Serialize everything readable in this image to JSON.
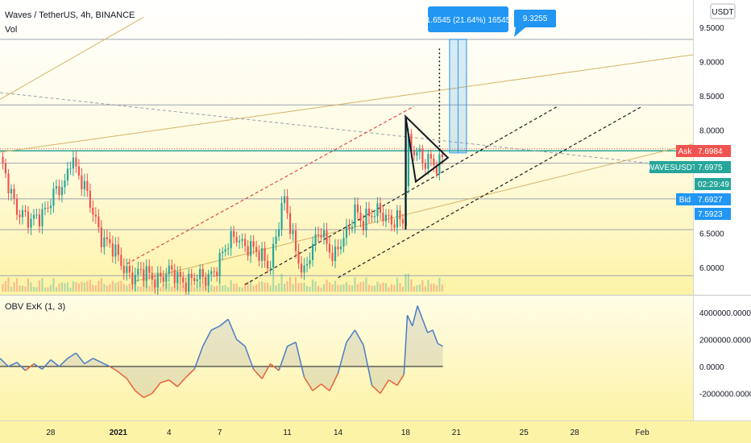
{
  "header": {
    "title": "Waves / TetherUS, 4h, BINANCE",
    "volume_label": "Vol",
    "currency_button": "USDT",
    "indicator_label": "OBV ExK (1, 3)"
  },
  "measure": {
    "label": "1.6545 (21.64%) 16545",
    "target_label": "9.3255"
  },
  "price_tags": {
    "ask_label": "Ask",
    "ask_value": "7.6984",
    "symbol_label": "WAVESUSDT",
    "last_value": "7.6975",
    "countdown": "02:29:49",
    "bid_label": "Bid",
    "bid_value": "7.6927",
    "level_value": "7.5923"
  },
  "colors": {
    "up": "#26a69a",
    "down": "#ef5350",
    "background_top": "#ffffff",
    "background_bottom": "#fdf3a6",
    "obv_above": "#4a7dc4",
    "obv_below": "#e8613b",
    "ask_tag": "#ef5350",
    "symbol_tag": "#26a69a",
    "bid_tag": "#2196f3",
    "measure_box": "#2196f3",
    "horizontal_level": "#9ea3b0"
  },
  "chart_data": [
    {
      "type": "candlestick",
      "title": "Waves / TetherUS, 4h, BINANCE",
      "y_ticks": [
        9.5,
        9.0,
        8.5,
        8.0,
        7.5,
        7.0,
        6.5,
        6.0
      ],
      "y_tick_labels": [
        "9.5000",
        "9.0000",
        "8.5000",
        "8.0000",
        "7.5000",
        "7.0000",
        "6.5000",
        "6.0000"
      ],
      "ylim": [
        5.7,
        9.65
      ],
      "x_tick_labels": [
        "28",
        "2021",
        "4",
        "7",
        "11",
        "14",
        "18",
        "21",
        "25",
        "28",
        "Feb"
      ],
      "x_ticks_day": [
        -4,
        0,
        3,
        6,
        10,
        13,
        17,
        20,
        24,
        27,
        31
      ],
      "xlim_day": [
        -7.0,
        34.0
      ],
      "horizontal_levels": [
        9.3255,
        8.37,
        7.7,
        7.52,
        7.0,
        6.55,
        5.88
      ],
      "anchors": [
        {
          "day": -7.0,
          "price": 7.5
        },
        {
          "day": -6.0,
          "price": 6.9
        },
        {
          "day": -5.2,
          "price": 6.6
        },
        {
          "day": -4.0,
          "price": 7.0
        },
        {
          "day": -3.2,
          "price": 7.15
        },
        {
          "day": -2.8,
          "price": 7.7
        },
        {
          "day": -2.0,
          "price": 7.1
        },
        {
          "day": -1.0,
          "price": 6.5
        },
        {
          "day": 0.0,
          "price": 6.1
        },
        {
          "day": 1.0,
          "price": 5.88
        },
        {
          "day": 3.0,
          "price": 5.88
        },
        {
          "day": 5.0,
          "price": 5.8
        },
        {
          "day": 6.0,
          "price": 6.1
        },
        {
          "day": 7.0,
          "price": 6.5
        },
        {
          "day": 8.0,
          "price": 6.2
        },
        {
          "day": 9.0,
          "price": 6.1
        },
        {
          "day": 9.8,
          "price": 6.95
        },
        {
          "day": 10.5,
          "price": 6.3
        },
        {
          "day": 11.0,
          "price": 5.9
        },
        {
          "day": 12.0,
          "price": 6.6
        },
        {
          "day": 12.8,
          "price": 6.1
        },
        {
          "day": 13.5,
          "price": 6.5
        },
        {
          "day": 14.0,
          "price": 6.9
        },
        {
          "day": 14.5,
          "price": 6.6
        },
        {
          "day": 15.5,
          "price": 6.9
        },
        {
          "day": 16.2,
          "price": 6.6
        },
        {
          "day": 16.9,
          "price": 6.7
        },
        {
          "day": 17.1,
          "price": 7.9
        },
        {
          "day": 17.6,
          "price": 7.7
        },
        {
          "day": 18.1,
          "price": 7.45
        },
        {
          "day": 18.6,
          "price": 7.6
        },
        {
          "day": 18.9,
          "price": 7.5
        },
        {
          "day": 19.2,
          "price": 7.7
        }
      ],
      "volume_scale": 6
    },
    {
      "type": "area",
      "title": "OBV ExK (1, 3)",
      "y_ticks": [
        4000000,
        2000000,
        0,
        -2000000
      ],
      "y_tick_labels": [
        "4000000.0000",
        "2000000.0000",
        "0.0000",
        "-2000000.0000"
      ],
      "ylim": [
        -2800000,
        5000000
      ],
      "baseline": 0,
      "x_day": [
        -7.0,
        -6.5,
        -6.0,
        -5.5,
        -5.0,
        -4.5,
        -4.0,
        -3.5,
        -3.0,
        -2.5,
        -2.0,
        -1.5,
        -1.0,
        -0.5,
        0.0,
        0.5,
        1.0,
        1.5,
        2.0,
        2.5,
        3.0,
        3.5,
        4.0,
        4.5,
        5.0,
        5.5,
        6.0,
        6.5,
        7.0,
        7.5,
        8.0,
        8.5,
        9.0,
        9.5,
        10.0,
        10.5,
        11.0,
        11.5,
        12.0,
        12.5,
        13.0,
        13.5,
        14.0,
        14.5,
        15.0,
        15.5,
        16.0,
        16.5,
        16.9,
        17.1,
        17.4,
        17.7,
        18.0,
        18.3,
        18.6,
        18.9,
        19.2
      ],
      "values": [
        600000,
        0,
        300000,
        -300000,
        200000,
        -200000,
        500000,
        0,
        600000,
        1000000,
        200000,
        600000,
        300000,
        0,
        -400000,
        -900000,
        -1800000,
        -2300000,
        -2000000,
        -1200000,
        -1000000,
        -1500000,
        -800000,
        -200000,
        1500000,
        2700000,
        3000000,
        3500000,
        2000000,
        1500000,
        -200000,
        -900000,
        200000,
        -300000,
        1500000,
        1800000,
        -800000,
        -1800000,
        -1300000,
        -1800000,
        -500000,
        1800000,
        2700000,
        1600000,
        -1400000,
        -2000000,
        -1000000,
        -1400000,
        -600000,
        3800000,
        3000000,
        4500000,
        3500000,
        2500000,
        2700000,
        1700000,
        1500000
      ]
    }
  ]
}
